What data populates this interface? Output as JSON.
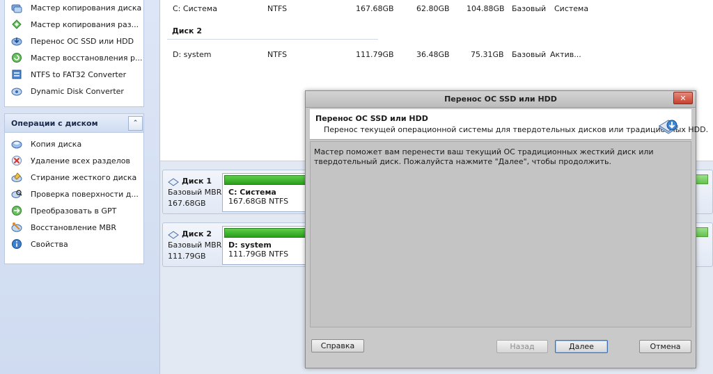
{
  "sidebar": {
    "wizards": [
      {
        "label": "Мастер копирования диска",
        "icon": "disk-copy-icon"
      },
      {
        "label": "Мастер копирования раз...",
        "icon": "partition-copy-icon"
      },
      {
        "label": "Перенос ОС SSD или HDD",
        "icon": "os-migrate-icon"
      },
      {
        "label": "Мастер восстановления р...",
        "icon": "partition-recovery-icon"
      },
      {
        "label": "NTFS to FAT32 Converter",
        "icon": "ntfs-fat32-icon"
      },
      {
        "label": "Dynamic Disk Converter",
        "icon": "dynamic-disk-icon"
      }
    ],
    "ops_title": "Операции с диском",
    "collapse_glyph": "⌃",
    "ops": [
      {
        "label": "Копия диска",
        "icon": "disk-copy-icon"
      },
      {
        "label": "Удаление всех разделов",
        "icon": "delete-partitions-icon"
      },
      {
        "label": "Стирание жесткого диска",
        "icon": "wipe-disk-icon"
      },
      {
        "label": "Проверка поверхности д...",
        "icon": "surface-test-icon"
      },
      {
        "label": "Преобразовать в GPT",
        "icon": "convert-gpt-icon"
      },
      {
        "label": "Восстановление MBR",
        "icon": "rebuild-mbr-icon"
      },
      {
        "label": "Свойства",
        "icon": "info-icon"
      }
    ]
  },
  "table": {
    "rows": [
      {
        "partition": "C: Система",
        "fs": "NTFS",
        "capacity": "167.68GB",
        "used": "62.80GB",
        "unused": "104.88GB",
        "type": "Базовый",
        "status": "Система"
      },
      {
        "partition": "D: system",
        "fs": "NTFS",
        "capacity": "111.79GB",
        "used": "36.48GB",
        "unused": "75.31GB",
        "type": "Базовый",
        "status": "Актив..."
      }
    ],
    "disk2_heading": "Диск 2"
  },
  "disks": [
    {
      "name": "Диск 1",
      "type": "Базовый MBR",
      "size": "167.68GB",
      "part_name": "C: Система",
      "part_detail": "167.68GB NTFS"
    },
    {
      "name": "Диск 2",
      "type": "Базовый MBR",
      "size": "111.79GB",
      "part_name": "D: system",
      "part_detail": "111.79GB NTFS"
    }
  ],
  "dialog": {
    "title": "Перенос ОС SSD или HDD",
    "close_glyph": "✕",
    "header_title": "Перенос ОС SSD или HDD",
    "header_subtitle": "Перенос текущей операционной системы для твердотельных дисков или традиционных HDD.",
    "body_text": "Мастер поможет вам перенести ваш текущий ОС традиционных жесткий диск или твердотельный диск. Пожалуйста нажмите \"Далее\", чтобы продолжить.",
    "buttons": {
      "help": "Справка",
      "back": "Назад",
      "next": "Далее",
      "cancel": "Отмена"
    }
  },
  "colors": {
    "partition_bar": "#2a9e1b",
    "close_button": "#c8412f",
    "sidebar_bg": "#dde6f6"
  }
}
